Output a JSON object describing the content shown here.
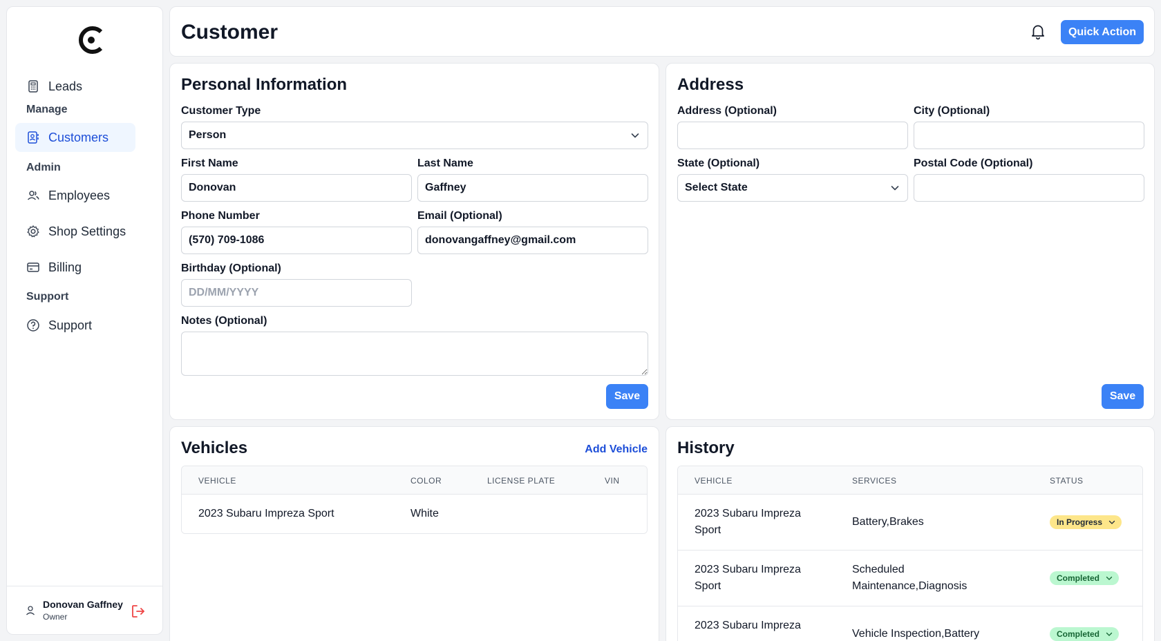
{
  "sidebar": {
    "nav": [
      {
        "label": "Leads",
        "icon": "calculator-icon"
      },
      {
        "label": "Customers",
        "icon": "contact-card-icon"
      },
      {
        "label": "Employees",
        "icon": "users-icon"
      },
      {
        "label": "Shop Settings",
        "icon": "gear-icon"
      },
      {
        "label": "Billing",
        "icon": "credit-card-icon"
      },
      {
        "label": "Support",
        "icon": "help-circle-icon"
      }
    ],
    "sections": {
      "manage": "Manage",
      "admin": "Admin",
      "support": "Support"
    },
    "user": {
      "name": "Donovan Gaffney",
      "role": "Owner"
    }
  },
  "header": {
    "title": "Customer",
    "quick_action": "Quick Action"
  },
  "personal": {
    "title": "Personal Information",
    "customer_type_label": "Customer Type",
    "customer_type_value": "Person",
    "first_name_label": "First Name",
    "first_name_value": "Donovan",
    "last_name_label": "Last Name",
    "last_name_value": "Gaffney",
    "phone_label": "Phone Number",
    "phone_value": "(570) 709-1086",
    "email_label": "Email (Optional)",
    "email_value": "donovangaffney@gmail.com",
    "birthday_label": "Birthday (Optional)",
    "birthday_placeholder": "DD/MM/YYYY",
    "notes_label": "Notes (Optional)",
    "save": "Save"
  },
  "address": {
    "title": "Address",
    "address_label": "Address (Optional)",
    "city_label": "City (Optional)",
    "state_label": "State (Optional)",
    "state_value": "Select State",
    "postal_label": "Postal Code (Optional)",
    "save": "Save"
  },
  "vehicles": {
    "title": "Vehicles",
    "add": "Add Vehicle",
    "columns": [
      "VEHICLE",
      "COLOR",
      "LICENSE PLATE",
      "VIN"
    ],
    "rows": [
      {
        "vehicle": "2023 Subaru Impreza Sport",
        "color": "White",
        "plate": "",
        "vin": ""
      }
    ]
  },
  "history": {
    "title": "History",
    "columns": [
      "VEHICLE",
      "SERVICES",
      "STATUS"
    ],
    "rows": [
      {
        "vehicle_line1": "2023 Subaru Impreza",
        "vehicle_line2": "Sport",
        "services_line1": "Battery,Brakes",
        "services_line2": "",
        "status": "In Progress"
      },
      {
        "vehicle_line1": "2023 Subaru Impreza",
        "vehicle_line2": "Sport",
        "services_line1": "Scheduled",
        "services_line2": "Maintenance,Diagnosis",
        "status": "Completed"
      },
      {
        "vehicle_line1": "2023 Subaru Impreza",
        "vehicle_line2": "",
        "services_line1": "Vehicle Inspection,Battery",
        "services_line2": "",
        "status": "Completed"
      }
    ]
  },
  "colors": {
    "accent": "#3b82f6",
    "active_bg": "#eff6ff",
    "in_progress": "#fde68a",
    "completed": "#bbf7d0"
  }
}
